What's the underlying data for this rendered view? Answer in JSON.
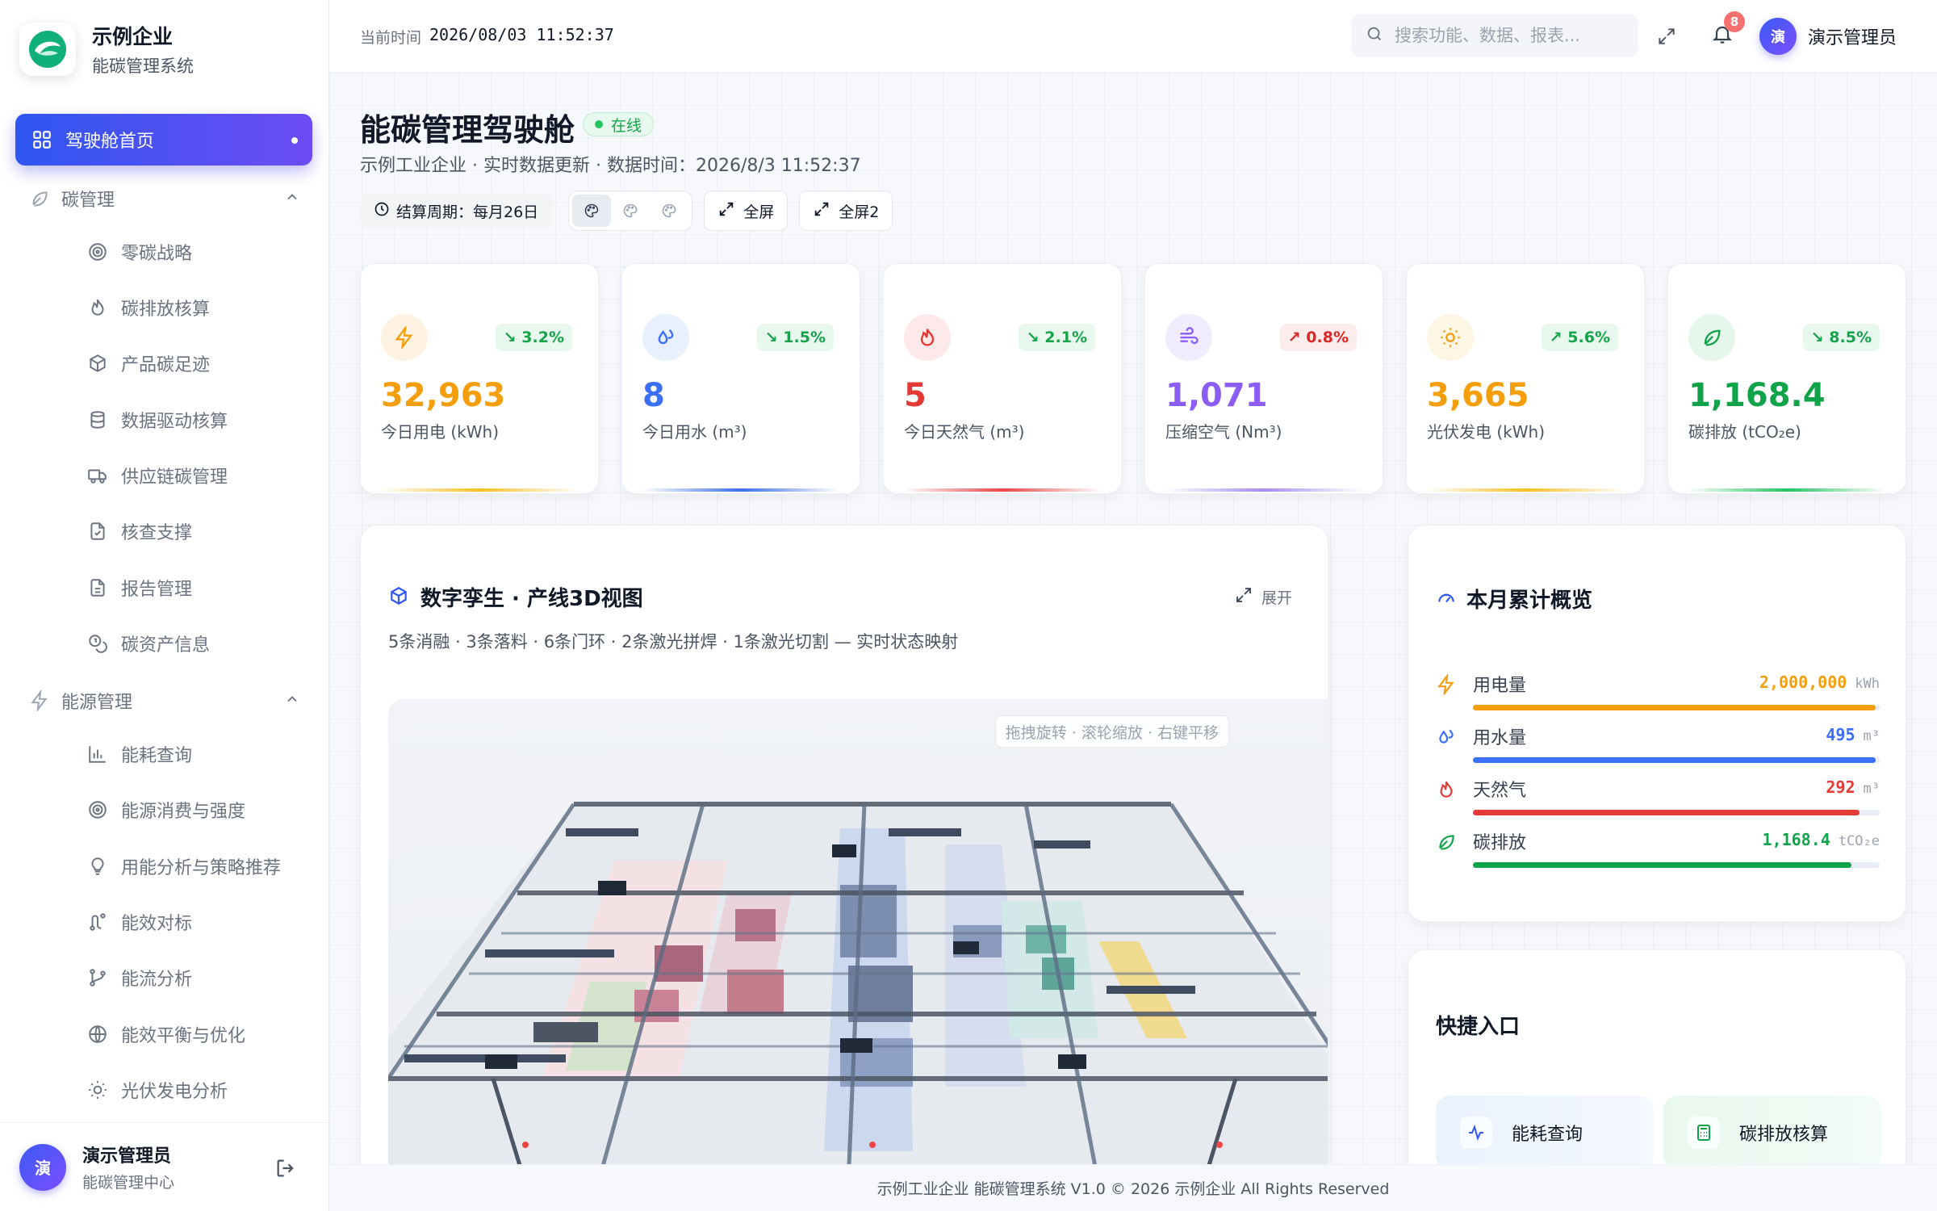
{
  "brand": {
    "name": "示例企业",
    "subtitle": "能碳管理系统"
  },
  "sidebar": {
    "home": "驾驶舱首页",
    "groups": [
      {
        "label": "碳管理",
        "items": [
          "零碳战略",
          "碳排放核算",
          "产品碳足迹",
          "数据驱动核算",
          "供应链碳管理",
          "核查支撑",
          "报告管理",
          "碳资产信息"
        ]
      },
      {
        "label": "能源管理",
        "items": [
          "能耗查询",
          "能源消费与强度",
          "用能分析与策略推荐",
          "能效对标",
          "能流分析",
          "能效平衡与优化",
          "光伏发电分析"
        ]
      }
    ],
    "user": {
      "avatar": "演",
      "name": "演示管理员",
      "role": "能碳管理中心"
    }
  },
  "topbar": {
    "time_label": "当前时间",
    "time_value": "2026/08/03 11:52:37",
    "search_placeholder": "搜索功能、数据、报表...",
    "notification_count": "8",
    "user_avatar": "演",
    "user_name": "演示管理员"
  },
  "header": {
    "title": "能碳管理驾驶舱",
    "status": "在线",
    "subtitle": "示例工业企业 · 实时数据更新 · 数据时间：2026/8/3 11:52:37",
    "cycle": "结算周期：每月26日",
    "fullscreen": "全屏",
    "fullscreen2": "全屏2"
  },
  "kpis": [
    {
      "icon": "bolt-icon",
      "trend": "3.2%",
      "trend_dir": "down",
      "value": "32,963",
      "label": "今日用电 (kWh)",
      "color": "#f59e0b",
      "bg": "#fef3e2"
    },
    {
      "icon": "water-drops-icon",
      "trend": "1.5%",
      "trend_dir": "down",
      "value": "8",
      "label": "今日用水 (m³)",
      "color": "#3b6ff5",
      "bg": "#e8effd"
    },
    {
      "icon": "flame-icon",
      "trend": "2.1%",
      "trend_dir": "down",
      "value": "5",
      "label": "今日天然气 (m³)",
      "color": "#e53935",
      "bg": "#fde9e9"
    },
    {
      "icon": "wind-icon",
      "trend": "0.8%",
      "trend_dir": "up",
      "value": "1,071",
      "label": "压缩空气 (Nm³)",
      "color": "#8b5cf6",
      "bg": "#f1ebfe"
    },
    {
      "icon": "sun-icon",
      "trend": "5.6%",
      "trend_dir": "up",
      "value": "3,665",
      "label": "光伏发电 (kWh)",
      "color": "#f59e0b",
      "bg": "#fef6e4"
    },
    {
      "icon": "leaf-icon",
      "trend": "8.5%",
      "trend_dir": "down",
      "value": "1,168.4",
      "label": "碳排放 (tCO₂e)",
      "color": "#10a34a",
      "bg": "#e6f6ec"
    }
  ],
  "twin": {
    "title": "数字孪生 · 产线3D视图",
    "expand": "展开",
    "subtitle": "5条消融 · 3条落料 · 6条门环 · 2条激光拼焊 · 1条激光切割 — 实时状态映射",
    "hint": "拖拽旋转 · 滚轮缩放 · 右键平移"
  },
  "summary": {
    "title": "本月累计概览",
    "rows": [
      {
        "label": "用电量",
        "value": "2,000,000",
        "unit": "kWh",
        "color": "#f59e0b",
        "fill": 0.99
      },
      {
        "label": "用水量",
        "value": "495",
        "unit": "m³",
        "color": "#3b6ff5",
        "fill": 0.99
      },
      {
        "label": "天然气",
        "value": "292",
        "unit": "m³",
        "color": "#e53935",
        "fill": 0.95
      },
      {
        "label": "碳排放",
        "value": "1,168.4",
        "unit": "tCO₂e",
        "color": "#10a34a",
        "fill": 0.93
      }
    ]
  },
  "quick": {
    "title": "快捷入口",
    "items": [
      {
        "label": "能耗查询",
        "icon": "activity-icon"
      },
      {
        "label": "碳排放核算",
        "icon": "calculator-icon"
      }
    ]
  },
  "footer": "示例工业企业 能碳管理系统 V1.0 © 2026 示例企业 All Rights Reserved"
}
